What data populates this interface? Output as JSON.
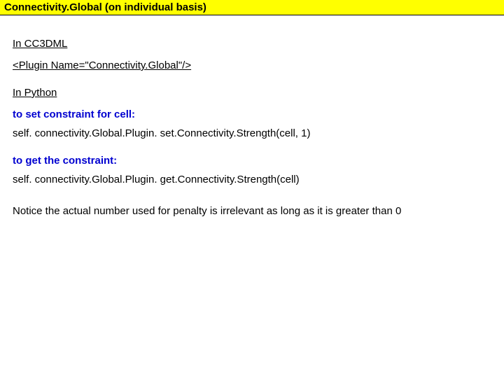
{
  "title": "Connectivity.Global (on individual basis)",
  "cc3dml_heading": "In CC3DML",
  "plugin_line": "<Plugin Name=\"Connectivity.Global\"/>",
  "python_heading": "In Python",
  "set_label": "to set constraint for cell:",
  "set_code": "self. connectivity.Global.Plugin. set.Connectivity.Strength(cell, 1)",
  "get_label": "to get the constraint:",
  "get_code": "self. connectivity.Global.Plugin. get.Connectivity.Strength(cell)",
  "note": "Notice the actual number used for penalty is irrelevant as long as it is greater than 0"
}
